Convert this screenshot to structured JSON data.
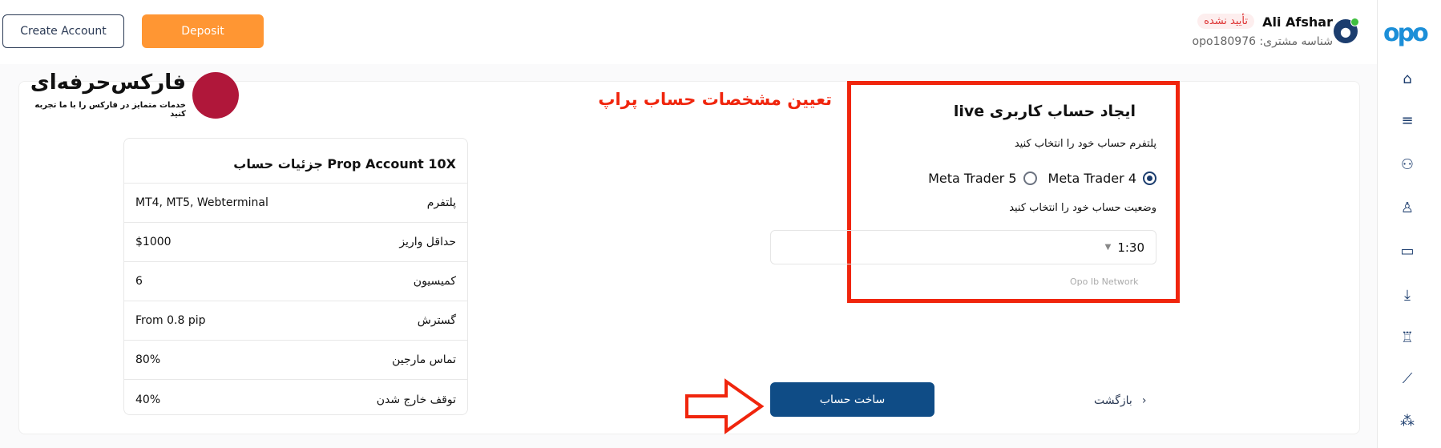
{
  "header": {
    "create_account": "Create Account",
    "deposit": "Deposit",
    "user_name": "Ali Afshar",
    "status_badge": "تأیید نشده",
    "customer_id": "شناسه مشتری: opo180976"
  },
  "brand": {
    "logo_text": "opo",
    "watermark_title": "فارکس‌حرفه‌ای",
    "watermark_subtitle": "خدمات متمایز در فارکس را با ما تجربه کنید"
  },
  "sidebar": {
    "items": [
      "home-icon",
      "trades-icon",
      "users-icon",
      "profile-icon",
      "wallet-icon",
      "download-icon",
      "trophy-icon",
      "chart-icon",
      "network-icon"
    ]
  },
  "annotation": {
    "title": "تعیین مشخصات حساب پراپ"
  },
  "details": {
    "title": "Prop Account 10X جزئیات حساب",
    "rows": [
      {
        "label": "پلتفرم",
        "value": "MT4, MT5, Webterminal"
      },
      {
        "label": "حداقل واریز",
        "value": "$1000"
      },
      {
        "label": "کمیسیون",
        "value": "6"
      },
      {
        "label": "گسترش",
        "value": "From 0.8 pip"
      },
      {
        "label": "تماس مارجین",
        "value": "80%"
      },
      {
        "label": "توقف خارج شدن",
        "value": "40%"
      }
    ]
  },
  "form": {
    "title": "ایجاد حساب کاربری live",
    "platform_label": "پلتفرم حساب خود را انتخاب کنید",
    "platforms": [
      {
        "label": "Meta Trader 4",
        "selected": true
      },
      {
        "label": "Meta Trader 5",
        "selected": false
      }
    ],
    "leverage_label": "وضعیت حساب خود را انتخاب کنید",
    "leverage_value": "1:30",
    "network": "Opo Ib Network",
    "submit": "ساخت حساب",
    "back": "بازگشت"
  },
  "colors": {
    "accent": "#0f4c86",
    "deposit": "#ff9633",
    "annotation": "#f0250d"
  }
}
